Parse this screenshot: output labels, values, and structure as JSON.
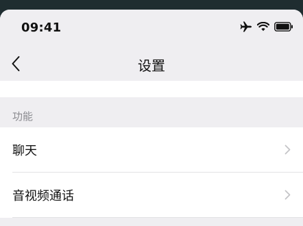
{
  "status_bar": {
    "time": "09:41",
    "icons": [
      "airplane-icon",
      "wifi-icon",
      "battery-icon"
    ]
  },
  "nav": {
    "back_icon": "chevron-left-icon",
    "title": "设置"
  },
  "section": {
    "header": "功能",
    "items": [
      {
        "label": "聊天",
        "icon": "chevron-right-icon"
      },
      {
        "label": "音视频通话",
        "icon": "chevron-right-icon"
      }
    ]
  },
  "colors": {
    "background": "#efeef1",
    "cell": "#ffffff",
    "section_text": "#8a8a8f",
    "chevron": "#c4c4c7",
    "outer": "#1f2d30"
  }
}
